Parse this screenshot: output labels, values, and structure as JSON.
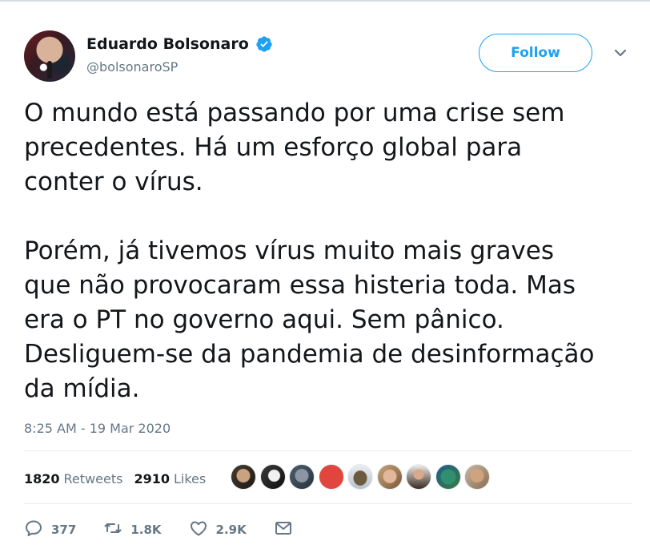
{
  "user": {
    "name": "Eduardo Bolsonaro",
    "handle": "@bolsonaroSP"
  },
  "follow_label": "Follow",
  "tweet": {
    "paragraph1": "O mundo está passando por uma crise sem\nprecedentes. Há um esforço global para\nconter o vírus.",
    "paragraph2": "Porém, já tivemos vírus muito mais graves\nque não provocaram essa histeria toda. Mas\nera o PT no governo aqui. Sem pânico.\nDesliguem-se da pandemia de desinformação\nda mídia."
  },
  "timestamp": "8:25 AM - 19 Mar 2020",
  "stats": {
    "retweets_count": "1820",
    "retweets_label": "Retweets",
    "likes_count": "2910",
    "likes_label": "Likes"
  },
  "actions": {
    "replies": "377",
    "retweets": "1.8K",
    "likes": "2.9K"
  },
  "colors": {
    "accent": "#1da1f2",
    "secondary_text": "#657786",
    "primary_text": "#14171a"
  },
  "icons": [
    "verified-icon",
    "chevron-down-icon",
    "reply-icon",
    "retweet-icon",
    "like-icon",
    "message-icon"
  ]
}
